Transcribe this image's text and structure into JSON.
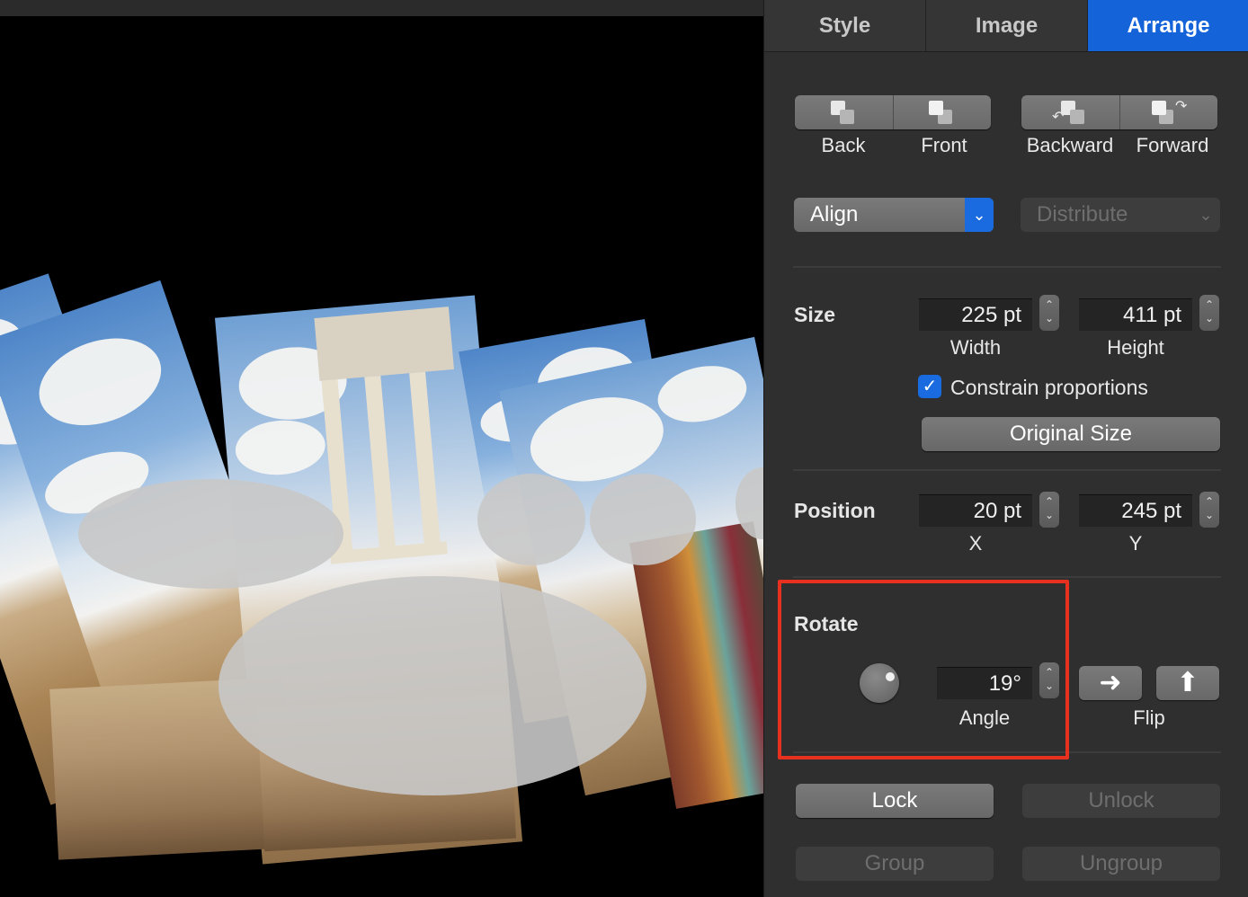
{
  "inspector": {
    "tabs": [
      {
        "label": "Style",
        "active": false
      },
      {
        "label": "Image",
        "active": false
      },
      {
        "label": "Arrange",
        "active": true
      }
    ],
    "layer_buttons": {
      "back": "Back",
      "front": "Front",
      "backward": "Backward",
      "forward": "Forward"
    },
    "align": {
      "label": "Align"
    },
    "distribute": {
      "label": "Distribute",
      "enabled": false
    },
    "size": {
      "title": "Size",
      "width_value": "225 pt",
      "width_label": "Width",
      "height_value": "411 pt",
      "height_label": "Height",
      "constrain_label": "Constrain proportions",
      "constrain_checked": true,
      "original_size_label": "Original Size"
    },
    "position": {
      "title": "Position",
      "x_value": "20 pt",
      "x_label": "X",
      "y_value": "245 pt",
      "y_label": "Y"
    },
    "rotate": {
      "title": "Rotate",
      "angle_value": "19°",
      "angle_label": "Angle",
      "flip_label": "Flip",
      "flip_horizontal_glyph": "➜",
      "flip_vertical_glyph": "⬆"
    },
    "lock": {
      "label": "Lock",
      "enabled": true
    },
    "unlock": {
      "label": "Unlock",
      "enabled": false
    },
    "group": {
      "label": "Group",
      "enabled": false
    },
    "ungroup": {
      "label": "Ungroup",
      "enabled": false
    },
    "colors": {
      "accent": "#1463d9",
      "highlight": "#e8301f"
    }
  },
  "icons": {
    "stepper_up": "⌃",
    "stepper_down": "⌄",
    "chevron": "⌄",
    "check": "✓"
  }
}
